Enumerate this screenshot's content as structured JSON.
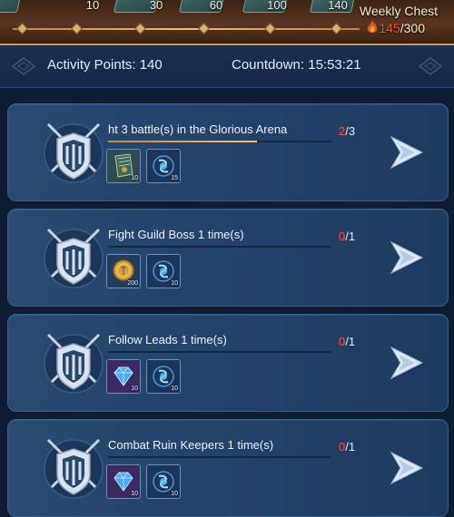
{
  "weekly_chest": {
    "title": "Weekly Chest",
    "current": "145",
    "total": "/300",
    "milestones": [
      {
        "label": "10"
      },
      {
        "label": "30"
      },
      {
        "label": "60"
      },
      {
        "label": "100"
      },
      {
        "label": "140"
      }
    ]
  },
  "info": {
    "activity_points": "Activity Points: 140",
    "countdown": "Countdown: 15:53:21"
  },
  "tasks": [
    {
      "title": "ht 3 battle(s) in the Glorious Arena",
      "current": "2",
      "total": "/3",
      "progress": 0.667,
      "rewards": [
        {
          "icon": "book-icon",
          "qty": "10"
        },
        {
          "icon": "blue-soul-orb-icon",
          "qty": "15"
        }
      ]
    },
    {
      "title": "Fight Guild Boss 1 time(s)",
      "current": "0",
      "total": "/1",
      "progress": 0,
      "rewards": [
        {
          "icon": "gold-coin-icon",
          "qty": "200"
        },
        {
          "icon": "blue-soul-orb-icon",
          "qty": "10"
        }
      ]
    },
    {
      "title": "Follow Leads 1 time(s)",
      "current": "0",
      "total": "/1",
      "progress": 0,
      "rewards": [
        {
          "icon": "blue-diamond-icon",
          "qty": "10"
        },
        {
          "icon": "blue-soul-orb-icon",
          "qty": "10"
        }
      ]
    },
    {
      "title": "Combat Ruin Keepers 1 time(s)",
      "current": "0",
      "total": "/1",
      "progress": 0,
      "rewards": [
        {
          "icon": "blue-diamond-icon",
          "qty": "10"
        },
        {
          "icon": "blue-soul-orb-icon",
          "qty": "10"
        }
      ]
    }
  ],
  "colors": {
    "accent_gold": "#f4c260",
    "progress_red": "#ff4e46",
    "card_blue": "#25426a"
  }
}
